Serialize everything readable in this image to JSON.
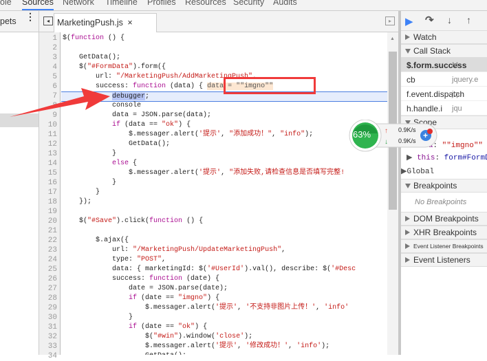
{
  "top_tabs": [
    "ole",
    "Sources",
    "Network",
    "Timeline",
    "Profiles",
    "Resources",
    "Security",
    "Audits"
  ],
  "selected_tab": "Sources",
  "left_panel": {
    "label": "pets"
  },
  "editor": {
    "file_tab": "MarketingPush.js",
    "execution_line": 7,
    "lines": [
      [
        [
          "p",
          "$("
        ],
        [
          "k",
          "function"
        ],
        [
          "p",
          " () {"
        ]
      ],
      [],
      [
        [
          "p",
          "    GetData();"
        ]
      ],
      [
        [
          "p",
          "    $("
        ],
        [
          "s",
          "\"#FormData\""
        ],
        [
          "p",
          ").form({"
        ]
      ],
      [
        [
          "p",
          "        url: "
        ],
        [
          "s",
          "\"/MarketingPush/AddMarketingPush\""
        ],
        [
          "p",
          ","
        ]
      ],
      [
        [
          "p",
          "        success: "
        ],
        [
          "k",
          "function"
        ],
        [
          "p",
          " (data) {"
        ],
        [
          "inl",
          "data = \"\"imgno\"\""
        ]
      ],
      [
        [
          "p",
          "            "
        ],
        [
          "dbg",
          "debugger"
        ],
        [
          "p",
          ";"
        ]
      ],
      [
        [
          "p",
          "            console"
        ]
      ],
      [
        [
          "p",
          "            data = JSON.parse(data);"
        ]
      ],
      [
        [
          "p",
          "            "
        ],
        [
          "k",
          "if"
        ],
        [
          "p",
          " (data == "
        ],
        [
          "s",
          "\"ok\""
        ],
        [
          "p",
          ") {"
        ]
      ],
      [
        [
          "p",
          "                $.messager.alert("
        ],
        [
          "s",
          "'提示'"
        ],
        [
          "p",
          ", "
        ],
        [
          "s",
          "\"添加成功！\""
        ],
        [
          "p",
          ", "
        ],
        [
          "s",
          "\"info\""
        ],
        [
          "p",
          ");"
        ]
      ],
      [
        [
          "p",
          "                GetData();"
        ]
      ],
      [
        [
          "p",
          "            }"
        ]
      ],
      [
        [
          "p",
          "            "
        ],
        [
          "k",
          "else"
        ],
        [
          "p",
          " {"
        ]
      ],
      [
        [
          "p",
          "                $.messager.alert("
        ],
        [
          "s",
          "'提示'"
        ],
        [
          "p",
          ", "
        ],
        [
          "s",
          "\"添加失败,请检查信息是否填写完整!"
        ]
      ],
      [
        [
          "p",
          "            }"
        ]
      ],
      [
        [
          "p",
          "        }"
        ]
      ],
      [
        [
          "p",
          "    });"
        ]
      ],
      [],
      [
        [
          "p",
          "    $("
        ],
        [
          "s",
          "\"#Save\""
        ],
        [
          "p",
          ").click("
        ],
        [
          "k",
          "function"
        ],
        [
          "p",
          " () {"
        ]
      ],
      [],
      [
        [
          "p",
          "        $.ajax({"
        ]
      ],
      [
        [
          "p",
          "            url: "
        ],
        [
          "s",
          "\"/MarketingPush/UpdateMarketingPush\""
        ],
        [
          "p",
          ","
        ]
      ],
      [
        [
          "p",
          "            type: "
        ],
        [
          "s",
          "\"POST\""
        ],
        [
          "p",
          ","
        ]
      ],
      [
        [
          "p",
          "            data: { marketingId: $("
        ],
        [
          "s",
          "'#UserId'"
        ],
        [
          "p",
          ").val(), describe: $("
        ],
        [
          "s",
          "'#Desc"
        ]
      ],
      [
        [
          "p",
          "            success: "
        ],
        [
          "k",
          "function"
        ],
        [
          "p",
          " (date) {"
        ]
      ],
      [
        [
          "p",
          "                date = JSON.parse(date);"
        ]
      ],
      [
        [
          "p",
          "                "
        ],
        [
          "k",
          "if"
        ],
        [
          "p",
          " (date == "
        ],
        [
          "s",
          "\"imgno\""
        ],
        [
          "p",
          ") {"
        ]
      ],
      [
        [
          "p",
          "                    $.messager.alert("
        ],
        [
          "s",
          "'提示'"
        ],
        [
          "p",
          ", "
        ],
        [
          "s",
          "'不支持非图片上传！'"
        ],
        [
          "p",
          ", "
        ],
        [
          "s",
          "'info'"
        ]
      ],
      [
        [
          "p",
          "                }"
        ]
      ],
      [
        [
          "p",
          "                "
        ],
        [
          "k",
          "if"
        ],
        [
          "p",
          " (date == "
        ],
        [
          "s",
          "\"ok\""
        ],
        [
          "p",
          ") {"
        ]
      ],
      [
        [
          "p",
          "                    $("
        ],
        [
          "s",
          "\"#win\""
        ],
        [
          "p",
          ").window("
        ],
        [
          "s",
          "'close'"
        ],
        [
          "p",
          ");"
        ]
      ],
      [
        [
          "p",
          "                    $.messager.alert("
        ],
        [
          "s",
          "'提示'"
        ],
        [
          "p",
          ", "
        ],
        [
          "s",
          "'修改成功！'"
        ],
        [
          "p",
          ", "
        ],
        [
          "s",
          "'info'"
        ],
        [
          "p",
          ");"
        ]
      ],
      [
        [
          "p",
          "                    GetData();"
        ]
      ]
    ]
  },
  "debugger": {
    "sections": {
      "watch": "Watch",
      "call_stack": "Call Stack",
      "scope": "Scope",
      "global": "Global",
      "breakpoints": "Breakpoints",
      "no_breakpoints": "No Breakpoints",
      "dom": "DOM Breakpoints",
      "xhr": "XHR Breakpoints",
      "event_listener_bp": "Event Listener Breakpoints",
      "event_listeners": "Event Listeners"
    },
    "call_stack": [
      {
        "fn": "$.form.success",
        "loc": "M"
      },
      {
        "fn": "cb",
        "loc": "jquery.e"
      },
      {
        "fn": "f.event.dispatch",
        "loc": "jqu"
      },
      {
        "fn": "h.handle.i",
        "loc": "jqu"
      }
    ],
    "scope_data": {
      "key": "data",
      "value": "\"\"imgno\"\""
    },
    "scope_this": {
      "key": "this",
      "value": "form#FormD"
    }
  },
  "net_widget": {
    "percent": "63%",
    "up": "0.9K/s",
    "down": "0.9K/s",
    "color": "#2fb44f"
  }
}
